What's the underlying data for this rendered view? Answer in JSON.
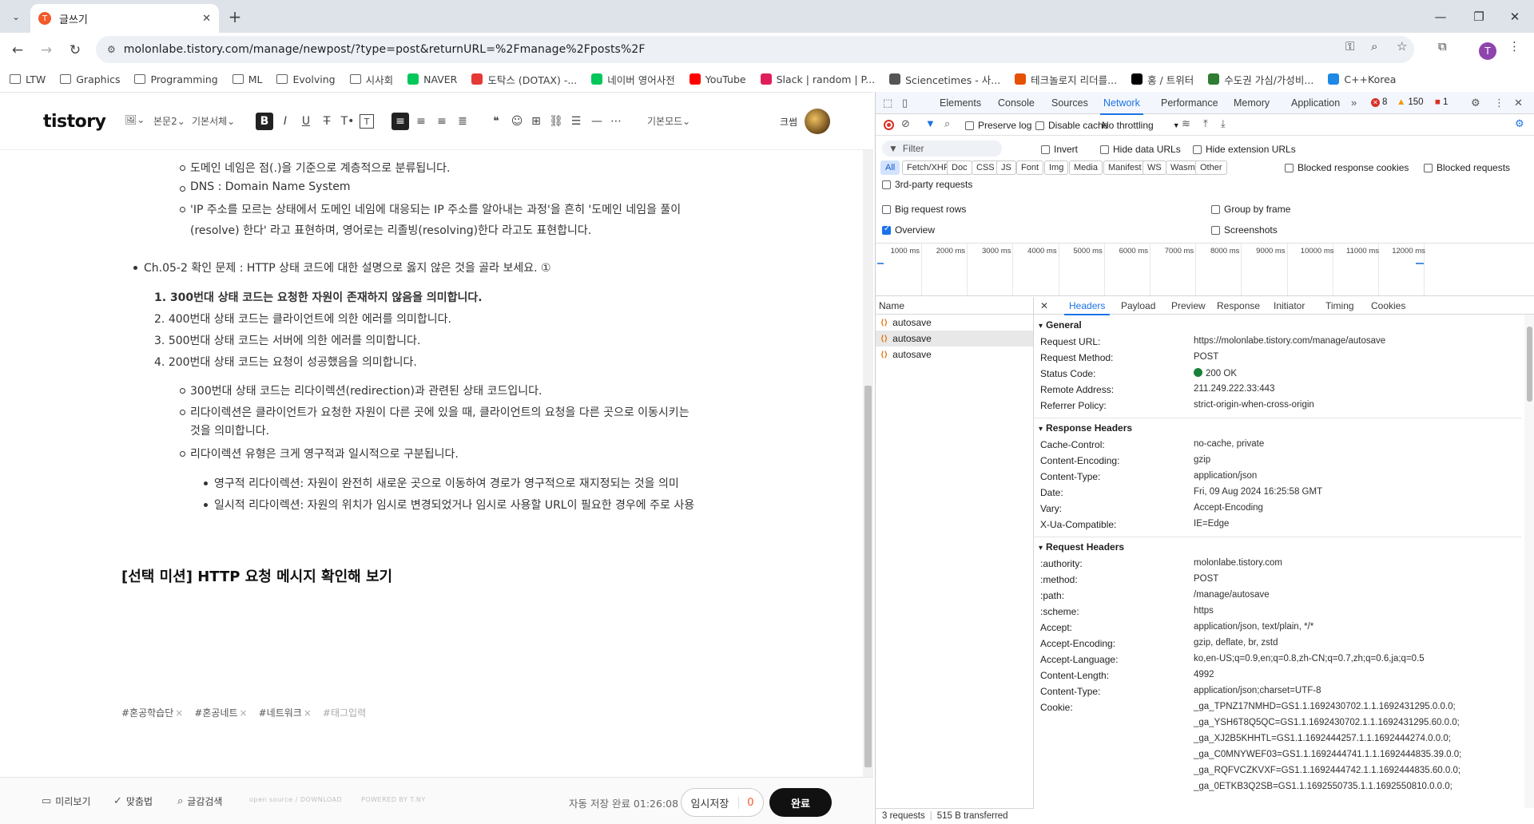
{
  "browser": {
    "tab_title": "글쓰기",
    "tab_favicon": "T",
    "url": "molonlabe.tistory.com/manage/newpost/?type=post&returnURL=%2Fmanage%2Fposts%2F",
    "profile_initial": "T",
    "bookmarks": [
      {
        "label": "LTW",
        "icon": "folder-icon"
      },
      {
        "label": "Graphics",
        "icon": "folder-icon"
      },
      {
        "label": "Programming",
        "icon": "folder-icon"
      },
      {
        "label": "ML",
        "icon": "folder-icon"
      },
      {
        "label": "Evolving",
        "icon": "folder-icon"
      },
      {
        "label": "시사회",
        "icon": "folder-icon"
      },
      {
        "label": "NAVER",
        "icon": "naver-icon",
        "color": "#03c75a"
      },
      {
        "label": "도탁스 (DOTAX) -...",
        "icon": "dotax-icon",
        "color": "#e53935"
      },
      {
        "label": "네이버 영어사전",
        "icon": "naver-dict-icon",
        "color": "#03c75a"
      },
      {
        "label": "YouTube",
        "icon": "youtube-icon",
        "color": "#ff0000"
      },
      {
        "label": "Slack | random | P...",
        "icon": "slack-icon",
        "color": "#e01e5a"
      },
      {
        "label": "Sciencetimes - 사...",
        "icon": "globe-icon",
        "color": "#555555"
      },
      {
        "label": "테크놀로지 리더를...",
        "icon": "mit-icon",
        "color": "#e65100"
      },
      {
        "label": "홍 / 트위터",
        "icon": "x-icon",
        "color": "#000000"
      },
      {
        "label": "수도권 가심/가성비...",
        "icon": "plus-icon",
        "color": "#2e7d32"
      },
      {
        "label": "C++Korea",
        "icon": "home-icon",
        "color": "#1e88e5"
      }
    ]
  },
  "editor": {
    "logo": "tistory",
    "format_paragraph": "본문2",
    "format_font": "기본서체",
    "format_mode": "기본모드",
    "user_name": "크썸",
    "content": {
      "line_domain_hierarchy": "도메인 네임은 점(.)을 기준으로 계층적으로 분류됩니다.",
      "line_dns": "DNS : Domain Name System",
      "line_resolve_1": "'IP 주소를 모르는 상태에서 도메인 네임에 대응되는 IP 주소를 알아내는 과정'을 흔히 '도메인 네임을 풀이",
      "line_resolve_2": "(resolve) 한다' 라고 표현하며, 영어로는 리졸빙(resolving)한다 라고도 표현합니다.",
      "question": "Ch.05-2 확인 문제 : HTTP 상태 코드에 대한 설명으로 옳지 않은 것을 골라 보세요. ①",
      "options": [
        {
          "num": "1.",
          "text": "300번대 상태 코드는 요청한 자원이 존재하지 않음을 의미합니다."
        },
        {
          "num": "2.",
          "text": "400번대 상태 코드는 클라이언트에 의한 에러를 의미합니다."
        },
        {
          "num": "3.",
          "text": "500번대 상태 코드는 서버에 의한 에러를 의미합니다."
        },
        {
          "num": "4.",
          "text": "200번대 상태 코드는 요청이 성공했음을 의미합니다."
        }
      ],
      "note_300": "300번대 상태 코드는 리다이렉션(redirection)과 관련된 상태 코드입니다.",
      "note_redirect_1": "리다이렉션은 클라이언트가 요청한 자원이 다른 곳에 있을 때, 클라이언트의 요청을 다른 곳으로 이동시키는",
      "note_redirect_2": "것을 의미합니다.",
      "note_types": "리다이렉션 유형은 크게 영구적과 일시적으로 구분됩니다.",
      "sub_permanent": "영구적 리다이렉션: 자원이 완전히 새로운 곳으로 이동하여 경로가 영구적으로 재지정되는 것을 의미",
      "sub_temporary": "일시적 리다이렉션: 자원의 위치가 임시로 변경되었거나 임시로 사용할 URL이 필요한 경우에 주로 사용",
      "section_title": "[선택 미션] HTTP 요청 메시지 확인해 보기"
    },
    "tags": [
      "#혼공학습단",
      "#혼공네트",
      "#네트워크"
    ],
    "tag_placeholder": "#태그입력",
    "footer": {
      "preview": "미리보기",
      "spellcheck": "맞춤법",
      "search": "글감검색",
      "open_source": "open source / DOWNLOAD",
      "powered": "POWERED BY T.NY",
      "autosave_status": "자동 저장 완료 01:26:08",
      "temp_save": "임시저장",
      "temp_save_count": "0",
      "publish": "완료"
    }
  },
  "devtools": {
    "tabs": [
      "Elements",
      "Console",
      "Sources",
      "Network",
      "Performance",
      "Memory",
      "Application"
    ],
    "active_tab": "Network",
    "errors": "8",
    "warnings": "150",
    "issues": "1",
    "toolbar": {
      "preserve_log": "Preserve log",
      "disable_cache": "Disable cache",
      "throttling": "No throttling"
    },
    "filter_placeholder": "Filter",
    "invert": "Invert",
    "hide_data_urls": "Hide data URLs",
    "hide_extension_urls": "Hide extension URLs",
    "types": [
      "All",
      "Fetch/XHR",
      "Doc",
      "CSS",
      "JS",
      "Font",
      "Img",
      "Media",
      "Manifest",
      "WS",
      "Wasm",
      "Other"
    ],
    "blocked_cookies": "Blocked response cookies",
    "blocked_requests": "Blocked requests",
    "third_party": "3rd-party requests",
    "big_rows": "Big request rows",
    "group_by_frame": "Group by frame",
    "overview": "Overview",
    "screenshots": "Screenshots",
    "timeline_ticks": [
      "1000 ms",
      "2000 ms",
      "3000 ms",
      "4000 ms",
      "5000 ms",
      "6000 ms",
      "7000 ms",
      "8000 ms",
      "9000 ms",
      "10000 ms",
      "11000 ms",
      "12000 ms"
    ],
    "name_header": "Name",
    "requests": [
      "autosave",
      "autosave",
      "autosave"
    ],
    "detail_tabs": [
      "Headers",
      "Payload",
      "Preview",
      "Response",
      "Initiator",
      "Timing",
      "Cookies"
    ],
    "general_title": "General",
    "general": [
      {
        "k": "Request URL:",
        "v": "https://molonlabe.tistory.com/manage/autosave"
      },
      {
        "k": "Request Method:",
        "v": "POST"
      },
      {
        "k": "Status Code:",
        "v": "200 OK"
      },
      {
        "k": "Remote Address:",
        "v": "211.249.222.33:443"
      },
      {
        "k": "Referrer Policy:",
        "v": "strict-origin-when-cross-origin"
      }
    ],
    "response_title": "Response Headers",
    "response": [
      {
        "k": "Cache-Control:",
        "v": "no-cache, private"
      },
      {
        "k": "Content-Encoding:",
        "v": "gzip"
      },
      {
        "k": "Content-Type:",
        "v": "application/json"
      },
      {
        "k": "Date:",
        "v": "Fri, 09 Aug 2024 16:25:58 GMT"
      },
      {
        "k": "Vary:",
        "v": "Accept-Encoding"
      },
      {
        "k": "X-Ua-Compatible:",
        "v": "IE=Edge"
      }
    ],
    "request_title": "Request Headers",
    "request": [
      {
        "k": ":authority:",
        "v": "molonlabe.tistory.com"
      },
      {
        "k": ":method:",
        "v": "POST"
      },
      {
        "k": ":path:",
        "v": "/manage/autosave"
      },
      {
        "k": ":scheme:",
        "v": "https"
      },
      {
        "k": "Accept:",
        "v": "application/json, text/plain, */*"
      },
      {
        "k": "Accept-Encoding:",
        "v": "gzip, deflate, br, zstd"
      },
      {
        "k": "Accept-Language:",
        "v": "ko,en-US;q=0.9,en;q=0.8,zh-CN;q=0.7,zh;q=0.6,ja;q=0.5"
      },
      {
        "k": "Content-Length:",
        "v": "4992"
      },
      {
        "k": "Content-Type:",
        "v": "application/json;charset=UTF-8"
      },
      {
        "k": "Cookie:",
        "v": "_ga_TPNZ17NMHD=GS1.1.1692430702.1.1.1692431295.0.0.0;"
      }
    ],
    "cookie_cont": [
      "_ga_YSH6T8Q5QC=GS1.1.1692430702.1.1.1692431295.60.0.0;",
      "_ga_XJ2B5KHHTL=GS1.1.1692444257.1.1.1692444274.0.0.0;",
      "_ga_C0MNYWEF03=GS1.1.1692444741.1.1.1692444835.39.0.0;",
      "_ga_RQFVCZKVXF=GS1.1.1692444742.1.1.1692444835.60.0.0;",
      "_ga_0ETKB3Q2SB=GS1.1.1692550735.1.1.1692550810.0.0.0;"
    ],
    "status_requests": "3 requests",
    "status_transferred": "515 B transferred"
  }
}
